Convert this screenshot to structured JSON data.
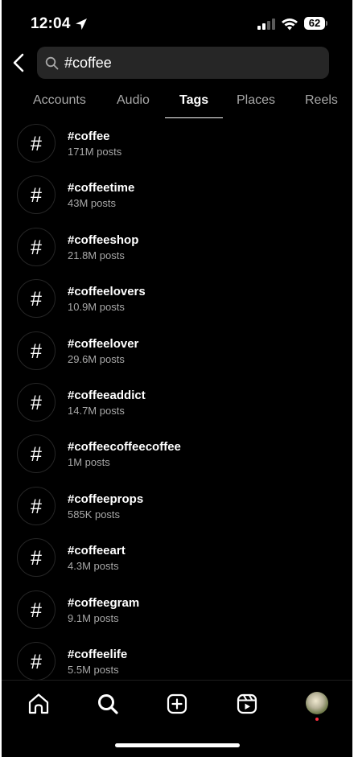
{
  "status_bar": {
    "time": "12:04",
    "battery": "62"
  },
  "search": {
    "value": "#coffee",
    "placeholder": "Search"
  },
  "tabs": [
    {
      "label": "Accounts",
      "active": false
    },
    {
      "label": "Audio",
      "active": false
    },
    {
      "label": "Tags",
      "active": true
    },
    {
      "label": "Places",
      "active": false
    },
    {
      "label": "Reels",
      "active": false
    }
  ],
  "results": [
    {
      "tag": "#coffee",
      "posts": "171M posts"
    },
    {
      "tag": "#coffeetime",
      "posts": "43M posts"
    },
    {
      "tag": "#coffeeshop",
      "posts": "21.8M posts"
    },
    {
      "tag": "#coffeelovers",
      "posts": "10.9M posts"
    },
    {
      "tag": "#coffeelover",
      "posts": "29.6M posts"
    },
    {
      "tag": "#coffeeaddict",
      "posts": "14.7M posts"
    },
    {
      "tag": "#coffeecoffeecoffee",
      "posts": "1M posts"
    },
    {
      "tag": "#coffeeprops",
      "posts": "585K posts"
    },
    {
      "tag": "#coffeeart",
      "posts": "4.3M posts"
    },
    {
      "tag": "#coffeegram",
      "posts": "9.1M posts"
    },
    {
      "tag": "#coffeelife",
      "posts": "5.5M posts"
    }
  ],
  "hash_symbol": "#",
  "icons": {
    "back": "chevron-left-icon",
    "search": "search-icon",
    "location": "location-arrow-icon",
    "nav": [
      "home-icon",
      "search-icon",
      "create-icon",
      "reels-icon",
      "profile-avatar"
    ]
  },
  "colors": {
    "background": "#000000",
    "text": "#ffffff",
    "secondary_text": "#a8a8a8",
    "search_field": "#262626",
    "notification_dot": "#ff3040"
  }
}
